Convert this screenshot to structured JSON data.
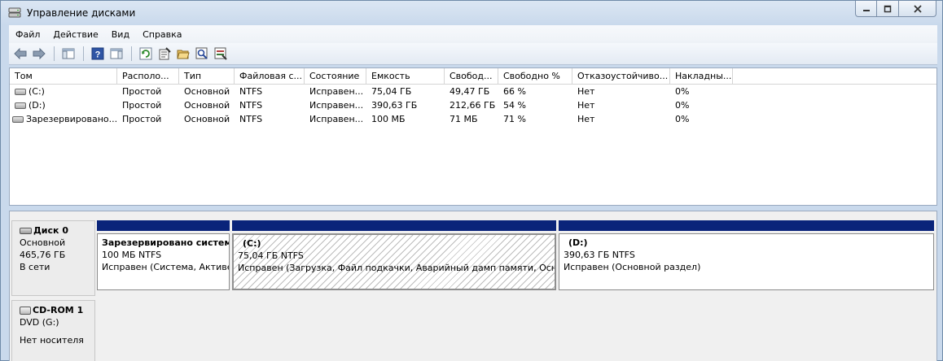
{
  "window": {
    "title": "Управление дисками",
    "icon": "disk-management-icon",
    "controls": [
      "minimize",
      "maximize",
      "close"
    ]
  },
  "menu": {
    "file": "Файл",
    "action": "Действие",
    "view": "Вид",
    "help": "Справка"
  },
  "toolbar": {
    "icons": [
      "back-arrow-icon",
      "forward-arrow-icon",
      "show-hide-console-tree-icon",
      "help-icon",
      "show-hide-action-pane-icon",
      "refresh-icon",
      "properties-icon",
      "open-folder-icon",
      "rescan-disks-icon",
      "export-list-icon"
    ]
  },
  "volumes": {
    "columns": [
      "Том",
      "Располо...",
      "Тип",
      "Файловая с...",
      "Состояние",
      "Емкость",
      "Свобод...",
      "Свободно %",
      "Отказоустойчиво...",
      "Накладны..."
    ],
    "rows": [
      [
        "(C:)",
        "Простой",
        "Основной",
        "NTFS",
        "Исправен...",
        "75,04 ГБ",
        "49,47 ГБ",
        "66 %",
        "Нет",
        "0%"
      ],
      [
        "(D:)",
        "Простой",
        "Основной",
        "NTFS",
        "Исправен...",
        "390,63 ГБ",
        "212,66 ГБ",
        "54 %",
        "Нет",
        "0%"
      ],
      [
        "Зарезервировано...",
        "Простой",
        "Основной",
        "NTFS",
        "Исправен...",
        "100 МБ",
        "71 МБ",
        "71 %",
        "Нет",
        "0%"
      ]
    ]
  },
  "disks": {
    "disk0": {
      "name": "Диск 0",
      "type": "Основной",
      "size": "465,76 ГБ",
      "status": "В сети"
    },
    "cdrom1": {
      "name": "CD-ROM 1",
      "type": "DVD (G:)",
      "status": "Нет носителя"
    }
  },
  "partitions": [
    {
      "name": "Зарезервировано системой",
      "size": "100 МБ NTFS",
      "status": "Исправен (Система, Активен, Основной раздел)"
    },
    {
      "name": "(C:)",
      "size": "75,04 ГБ NTFS",
      "status": "Исправен (Загрузка, Файл подкачки, Аварийный дамп памяти, Основной раздел)"
    },
    {
      "name": "(D:)",
      "size": "390,63 ГБ NTFS",
      "status": "Исправен (Основной раздел)"
    }
  ],
  "colors": {
    "partition_bar": "#0a247a",
    "title_bg": "#cfdcec"
  }
}
